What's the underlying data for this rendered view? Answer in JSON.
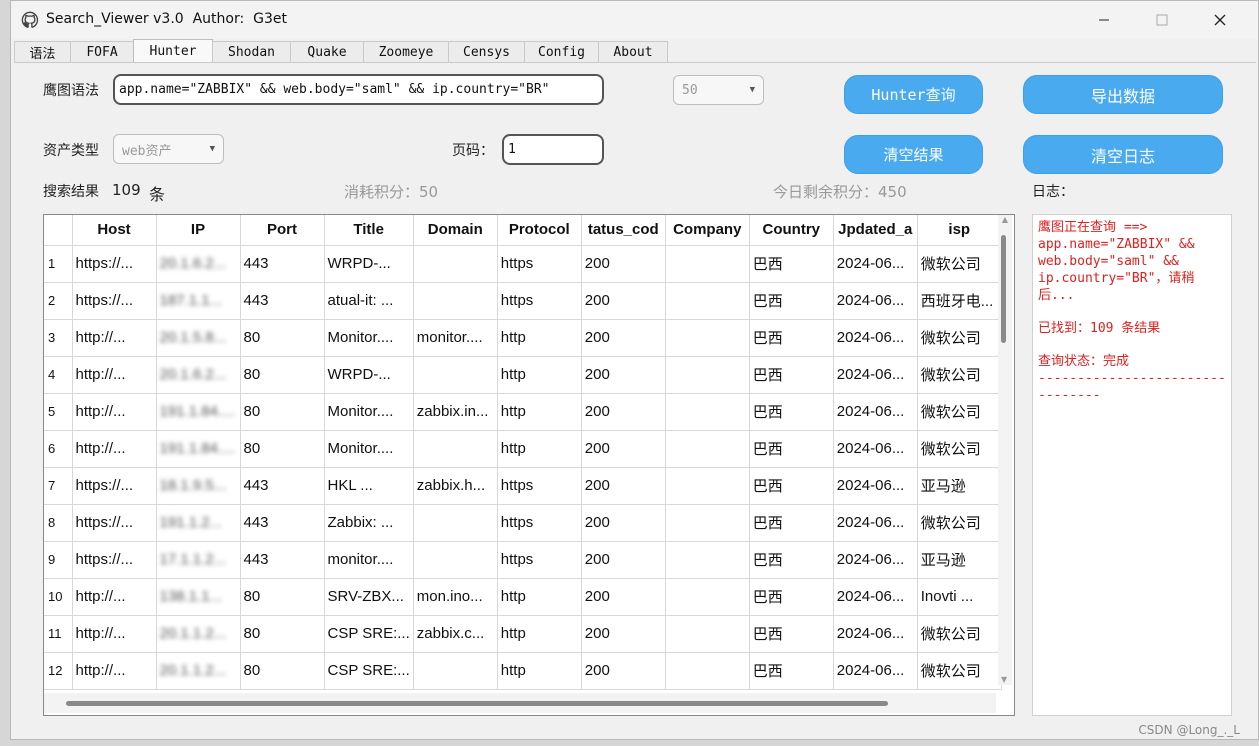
{
  "window": {
    "title": "Search_Viewer v3.0  Author:  G3et"
  },
  "tabs": [
    {
      "label": "语法"
    },
    {
      "label": "FOFA"
    },
    {
      "label": "Hunter"
    },
    {
      "label": "Shodan"
    },
    {
      "label": "Quake"
    },
    {
      "label": "Zoomeye"
    },
    {
      "label": "Censys"
    },
    {
      "label": "Config"
    },
    {
      "label": "About"
    }
  ],
  "active_tab": "Hunter",
  "query": {
    "label": "鹰图语法",
    "value": "app.name=\"ZABBIX\" && web.body=\"saml\" && ip.country=\"BR\""
  },
  "page_size": {
    "value": "50"
  },
  "asset_type": {
    "label": "资产类型",
    "value": "web资产"
  },
  "page": {
    "label": "页码：",
    "value": "1"
  },
  "buttons": {
    "search": "Hunter查询",
    "export": "导出数据",
    "clear_results": "清空结果",
    "clear_log": "清空日志"
  },
  "stats": {
    "results_label": "搜索结果",
    "results_count": "109",
    "results_unit": "条",
    "spent": "消耗积分：50",
    "remaining": "今日剩余积分：450"
  },
  "log_label": "日志：",
  "table": {
    "columns": [
      "",
      "Host",
      "IP",
      "Port",
      "Title",
      "Domain",
      "Protocol",
      "tatus_cod",
      "Company",
      "Country",
      "Jpdated_a",
      "isp"
    ],
    "rows": [
      [
        "1",
        "https://...",
        "20.1.6.2...",
        "443",
        "WRPD-...",
        "",
        "https",
        "200",
        "",
        "巴西",
        "2024-06...",
        "微软公司"
      ],
      [
        "2",
        "https://...",
        "187.1.1...",
        "443",
        "atual-it: ...",
        "",
        "https",
        "200",
        "",
        "巴西",
        "2024-06...",
        "西班牙电..."
      ],
      [
        "3",
        "http://...",
        "20.1.5.8...",
        "80",
        "Monitor....",
        "monitor....",
        "http",
        "200",
        "",
        "巴西",
        "2024-06...",
        "微软公司"
      ],
      [
        "4",
        "http://...",
        "20.1.6.2...",
        "80",
        "WRPD-...",
        "",
        "http",
        "200",
        "",
        "巴西",
        "2024-06...",
        "微软公司"
      ],
      [
        "5",
        "http://...",
        "191.1.84....",
        "80",
        "Monitor....",
        "zabbix.in...",
        "http",
        "200",
        "",
        "巴西",
        "2024-06...",
        "微软公司"
      ],
      [
        "6",
        "http://...",
        "191.1.84....",
        "80",
        "Monitor....",
        "",
        "http",
        "200",
        "",
        "巴西",
        "2024-06...",
        "微软公司"
      ],
      [
        "7",
        "https://...",
        "18.1.9.5...",
        "443",
        "HKL ...",
        "zabbix.h...",
        "https",
        "200",
        "",
        "巴西",
        "2024-06...",
        "亚马逊"
      ],
      [
        "8",
        "https://...",
        "191.1.2...",
        "443",
        "Zabbix: ...",
        "",
        "https",
        "200",
        "",
        "巴西",
        "2024-06...",
        "微软公司"
      ],
      [
        "9",
        "https://...",
        "17.1.1.2...",
        "443",
        "monitor....",
        "",
        "https",
        "200",
        "",
        "巴西",
        "2024-06...",
        "亚马逊"
      ],
      [
        "10",
        "http://...",
        "138.1.1...",
        "80",
        "SRV-ZBX...",
        "mon.ino...",
        "http",
        "200",
        "",
        "巴西",
        "2024-06...",
        "Inovti ..."
      ],
      [
        "11",
        "http://...",
        "20.1.1.2...",
        "80",
        "CSP SRE:...",
        "zabbix.c...",
        "http",
        "200",
        "",
        "巴西",
        "2024-06...",
        "微软公司"
      ],
      [
        "12",
        "http://...",
        "20.1.1.2...",
        "80",
        "CSP SRE:...",
        "",
        "http",
        "200",
        "",
        "巴西",
        "2024-06...",
        "微软公司"
      ]
    ]
  },
  "log_lines": [
    "鹰图正在查询 ==> app.name=\"ZABBIX\" && web.body=\"saml\" && ip.country=\"BR\"，请稍后...",
    "已找到：109 条结果",
    "查询状态：完成\n--------------------------------"
  ],
  "watermark": "CSDN @Long_._L",
  "colors": {
    "button": "#4aaaf0",
    "log_text": "#e02020"
  },
  "icons": {
    "app": "github-icon",
    "minimize": "minimize-icon",
    "maximize": "maximize-icon",
    "close": "close-icon"
  }
}
